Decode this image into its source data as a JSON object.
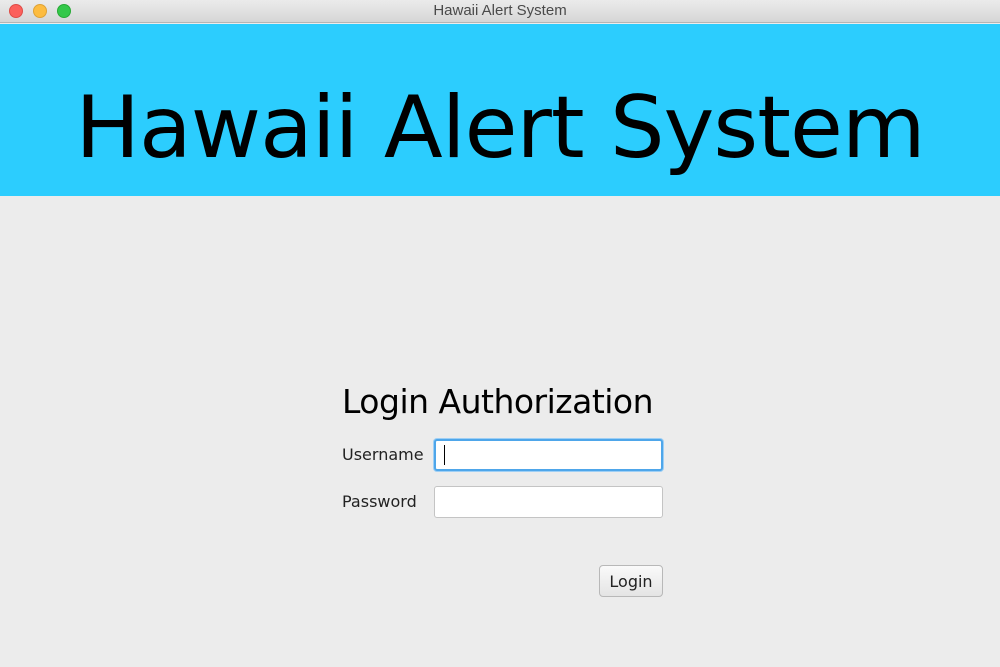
{
  "window": {
    "title": "Hawaii Alert System"
  },
  "banner": {
    "title": "Hawaii Alert System",
    "background_color": "#2ccdfe"
  },
  "login": {
    "heading": "Login Authorization",
    "username_label": "Username",
    "username_value": "",
    "password_label": "Password",
    "password_value": "",
    "login_button_label": "Login",
    "focused_field": "username"
  },
  "colors": {
    "focus_ring": "#4ea6ea",
    "window_background": "#ececec"
  }
}
